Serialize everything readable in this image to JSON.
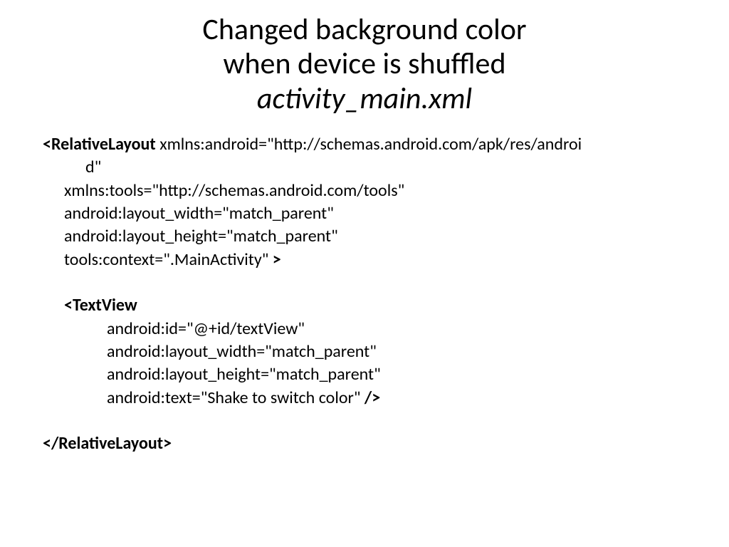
{
  "title": {
    "line1": "Changed background color",
    "line2": "when device is shuffled",
    "line3": "activity_main.xml"
  },
  "code": {
    "rl_open": "<RelativeLayout",
    "rl_xmlns1a": " xmlns:android=\"http://schemas.android.com/apk/res/androi",
    "rl_xmlns1b": "d\"",
    "rl_xmlns2": "xmlns:tools=\"http://schemas.android.com/tools\"",
    "rl_width": "android:layout_width=\"match_parent\"",
    "rl_height": "android:layout_height=\"match_parent\"",
    "rl_context": "tools:context=\".MainActivity\" ",
    "gt": ">",
    "tv_open": "<TextView",
    "tv_id": "android:id=\"@+id/textView\"",
    "tv_width": "android:layout_width=\"match_parent\"",
    "tv_height": "android:layout_height=\"match_parent\"",
    "tv_text": "android:text=\"Shake to switch color\" ",
    "slashgt": "/>",
    "rl_close": "</RelativeLayout>"
  }
}
